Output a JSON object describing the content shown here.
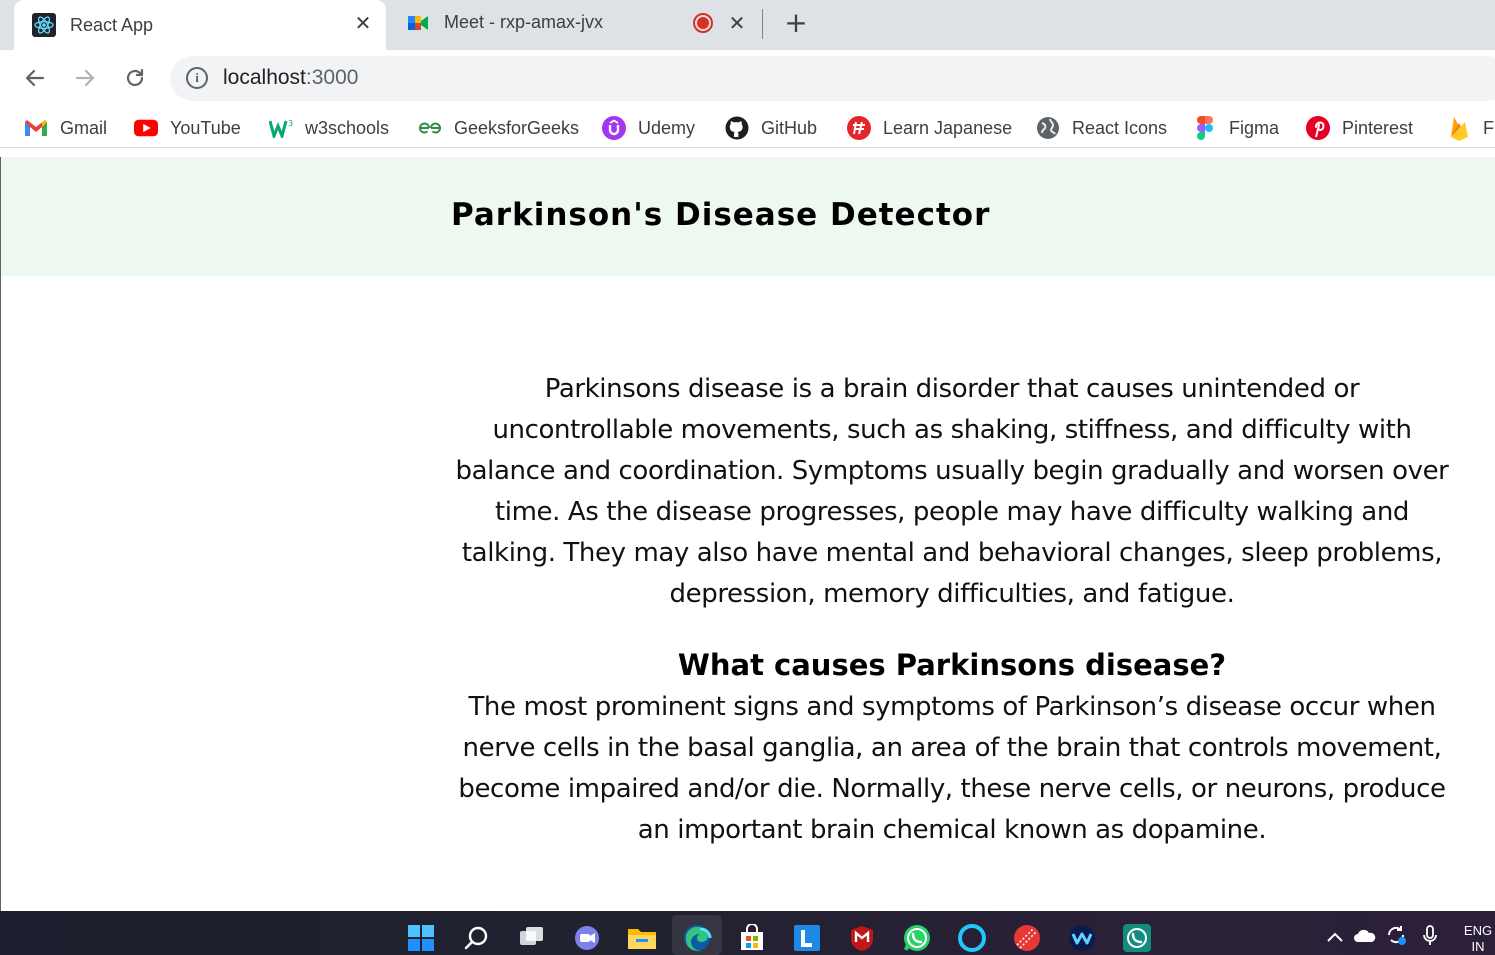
{
  "browser": {
    "tabs": [
      {
        "title": "React App",
        "favicon": "react-icon",
        "active": true
      },
      {
        "title": "Meet - rxp-amax-jvx",
        "favicon": "google-meet-icon",
        "recording": true,
        "active": false
      }
    ],
    "new_tab_label": "+",
    "close_glyph": "✕",
    "address": {
      "host": "localhost",
      "port": ":3000"
    },
    "bookmarks": [
      {
        "label": "Gmail",
        "icon": "gmail-icon"
      },
      {
        "label": "YouTube",
        "icon": "youtube-icon"
      },
      {
        "label": "w3schools",
        "icon": "w3schools-icon"
      },
      {
        "label": "GeeksforGeeks",
        "icon": "geeksforgeeks-icon"
      },
      {
        "label": "Udemy",
        "icon": "udemy-icon"
      },
      {
        "label": "GitHub",
        "icon": "github-icon"
      },
      {
        "label": "Learn Japanese",
        "icon": "learn-japanese-icon"
      },
      {
        "label": "React Icons",
        "icon": "globe-icon"
      },
      {
        "label": "Figma",
        "icon": "figma-icon"
      },
      {
        "label": "Pinterest",
        "icon": "pinterest-icon"
      },
      {
        "label": "Fi",
        "icon": "firebase-icon"
      }
    ]
  },
  "app": {
    "title": "Parkinson's Disease Detector",
    "intro": "Parkinsons disease is a brain disorder that causes unintended or uncontrollable movements, such as shaking, stiffness, and difficulty with balance and coordination. Symptoms usually begin gradually and worsen over time. As the disease progresses, people may have difficulty walking and talking. They may also have mental and behavioral changes, sleep problems, depression, memory difficulties, and fatigue.",
    "causes_heading": "What causes Parkinsons disease?",
    "causes_text": "The most prominent signs and symptoms of Parkinson’s disease occur when nerve cells in the basal ganglia, an area of the brain that controls movement, become impaired and/or die. Normally, these nerve cells, or neurons, produce an important brain chemical known as dopamine."
  },
  "taskbar": {
    "language": "ENG",
    "region": "IN",
    "apps": [
      "windows-start-icon",
      "search-icon",
      "task-view-icon",
      "teams-chat-icon",
      "file-explorer-icon",
      "edge-icon",
      "microsoft-store-icon",
      "l-app-icon",
      "mcafee-icon",
      "whatsapp-icon",
      "cortana-icon",
      "cricket-icon",
      "webex-icon",
      "whatsapp-business-icon"
    ]
  },
  "colors": {
    "header_bg": "#edf8ee",
    "tabstrip_bg": "#dee1e6",
    "record_red": "#d93025"
  }
}
